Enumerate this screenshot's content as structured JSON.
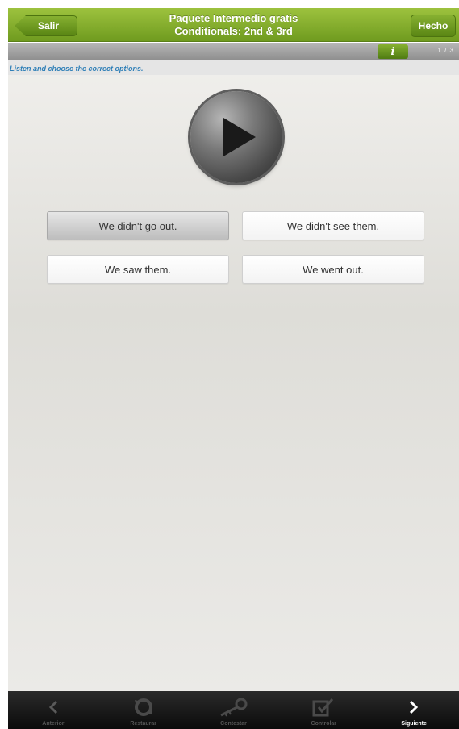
{
  "header": {
    "back_label": "Salir",
    "title_line1": "Paquete Intermedio gratis",
    "title_line2": "Conditionals: 2nd & 3rd",
    "done_label": "Hecho"
  },
  "subbar": {
    "info_label": "i",
    "page_indicator": "1 / 3"
  },
  "instruction": "Listen and choose the correct options.",
  "options": [
    {
      "label": "We didn't go out.",
      "selected": true
    },
    {
      "label": "We didn't see them.",
      "selected": false
    },
    {
      "label": "We saw them.",
      "selected": false
    },
    {
      "label": "We went out.",
      "selected": false
    }
  ],
  "bottom_nav": [
    {
      "label": "Anterior",
      "icon": "chevron-left-icon"
    },
    {
      "label": "Restaurar",
      "icon": "refresh-icon"
    },
    {
      "label": "Contestar",
      "icon": "key-icon"
    },
    {
      "label": "Controlar",
      "icon": "check-box-icon"
    },
    {
      "label": "Siguiente",
      "icon": "chevron-right-icon"
    }
  ],
  "colors": {
    "header_green": "#7fa92b",
    "instruction_blue": "#2f7fb7",
    "bottom_bar": "#111111"
  }
}
